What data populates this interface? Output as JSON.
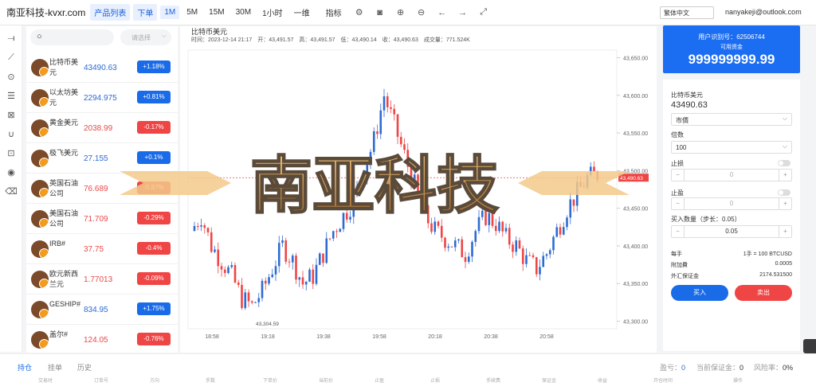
{
  "topbar": {
    "site_title": "南亚科技-kvxr.com",
    "tab_list": "产品列表",
    "tab_order": "下单",
    "tf": [
      "1M",
      "5M",
      "15M",
      "30M",
      "1小时",
      "一维"
    ],
    "indicator": "指标",
    "lang": "繁体中文",
    "email": "nanyakeji@outlook.com"
  },
  "symbols": {
    "search_placeholder": "",
    "select_placeholder": "请选择",
    "items": [
      {
        "name": "比特币美元",
        "price": "43490.63",
        "change": "+1.18%",
        "dir": "up"
      },
      {
        "name": "以太坊美元",
        "price": "2294.975",
        "change": "+0.81%",
        "dir": "up"
      },
      {
        "name": "黄金美元",
        "price": "2038.99",
        "change": "-0.17%",
        "dir": "down"
      },
      {
        "name": "极飞美元",
        "price": "27.155",
        "change": "+0.1%",
        "dir": "up"
      },
      {
        "name": "英国石油公司",
        "price": "76.689",
        "change": "-0.87%",
        "dir": "down"
      },
      {
        "name": "美国石油公司",
        "price": "71.709",
        "change": "-0.29%",
        "dir": "down"
      },
      {
        "name": "IRB#",
        "price": "37.75",
        "change": "-0.4%",
        "dir": "down"
      },
      {
        "name": "欧元新西兰元",
        "price": "1.77013",
        "change": "-0.09%",
        "dir": "down"
      },
      {
        "name": "GESHIP#",
        "price": "834.95",
        "change": "+1.75%",
        "dir": "up"
      },
      {
        "name": "盖尔#",
        "price": "124.05",
        "change": "-0.76%",
        "dir": "down"
      }
    ]
  },
  "chart": {
    "title": "比特币美元",
    "info": "时间：2023-12-14 21:17　开：43,491.57　高：43,491.57　低：43,490.14　收：43,490.63　成交量：771.524K",
    "y_ticks": [
      "43,650.00",
      "43,600.00",
      "43,550.00",
      "43,500.00",
      "43,450.00",
      "43,400.00",
      "43,350.00",
      "43,300.00"
    ],
    "x_ticks": [
      "18:58",
      "19:18",
      "19:38",
      "19:58",
      "20:18",
      "20:38",
      "20:58"
    ],
    "last_price": "43,490.63",
    "low_label": "43,304.59",
    "ylim": [
      43290,
      43660
    ]
  },
  "account": {
    "user_label": "用户识别号：",
    "user_id": "62506744",
    "avail_label": "可用资金",
    "balance": "999999999.99"
  },
  "order": {
    "symbol": "比特币美元",
    "price": "43490.63",
    "type": "市價",
    "lev_label": "倍数",
    "leverage": "100",
    "sl_label": "止损",
    "sl_value": "0",
    "tp_label": "止盈",
    "tp_value": "0",
    "qty_label": "买入数量（步长：0.05）",
    "qty": "0.05",
    "minus": "−",
    "plus": "+",
    "kv": [
      {
        "k": "每手",
        "v": "1手 = 100 BTCUSD"
      },
      {
        "k": "附加費",
        "v": "0.0005"
      },
      {
        "k": "外汇保证金",
        "v": "2174.531500"
      }
    ],
    "buy": "买入",
    "sell": "卖出"
  },
  "bottom": {
    "tabs": [
      "持仓",
      "挂单",
      "历史"
    ],
    "pnl_label": "盈亏：",
    "pnl": "0",
    "margin_label": "当前保证金：",
    "margin": "0",
    "risk_label": "风险率：",
    "risk": "0%",
    "cols": [
      "交易时",
      "订单号",
      "方向",
      "手数",
      "下单价",
      "当前价",
      "止盈",
      "止损",
      "手续费",
      "保证金",
      "收益",
      "开仓时间",
      "操作"
    ]
  },
  "watermark": "南亚科技",
  "colors": {
    "accent": "#1b6df2",
    "up": "#2d6bd3",
    "down": "#ef4545"
  }
}
